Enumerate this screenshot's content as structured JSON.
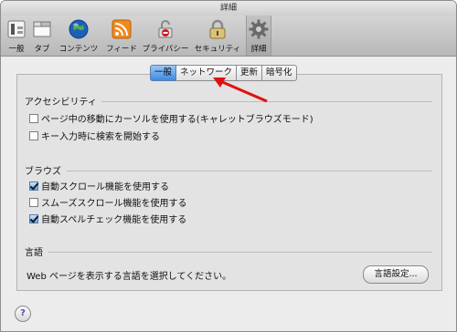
{
  "window": {
    "title": "詳細"
  },
  "toolbar": {
    "items": [
      {
        "label": "一般",
        "icon": "switch-icon"
      },
      {
        "label": "タブ",
        "icon": "tabs-icon"
      },
      {
        "label": "コンテンツ",
        "icon": "globe-icon"
      },
      {
        "label": "フィード",
        "icon": "rss-icon"
      },
      {
        "label": "プライバシー",
        "icon": "lock-icon"
      },
      {
        "label": "セキュリティ",
        "icon": "padlock-icon"
      },
      {
        "label": "詳細",
        "icon": "gear-icon",
        "selected": true
      }
    ]
  },
  "tabs": [
    {
      "label": "一般",
      "active": true
    },
    {
      "label": "ネットワーク"
    },
    {
      "label": "更新"
    },
    {
      "label": "暗号化"
    }
  ],
  "accessibility": {
    "title": "アクセシビリティ",
    "options": [
      {
        "label": "ページ中の移動にカーソルを使用する(キャレットブラウズモード)",
        "checked": false
      },
      {
        "label": "キー入力時に検索を開始する",
        "checked": false
      }
    ]
  },
  "browse": {
    "title": "ブラウズ",
    "options": [
      {
        "label": "自動スクロール機能を使用する",
        "checked": true
      },
      {
        "label": "スムーズスクロール機能を使用する",
        "checked": false
      },
      {
        "label": "自動スペルチェック機能を使用する",
        "checked": true
      }
    ]
  },
  "language": {
    "title": "言語",
    "description": "Web ページを表示する言語を選択してください。",
    "button": "言語設定..."
  },
  "help": {
    "label": "?"
  },
  "colors": {
    "accent": "#3b8ae4",
    "annotation": "#e01010"
  }
}
